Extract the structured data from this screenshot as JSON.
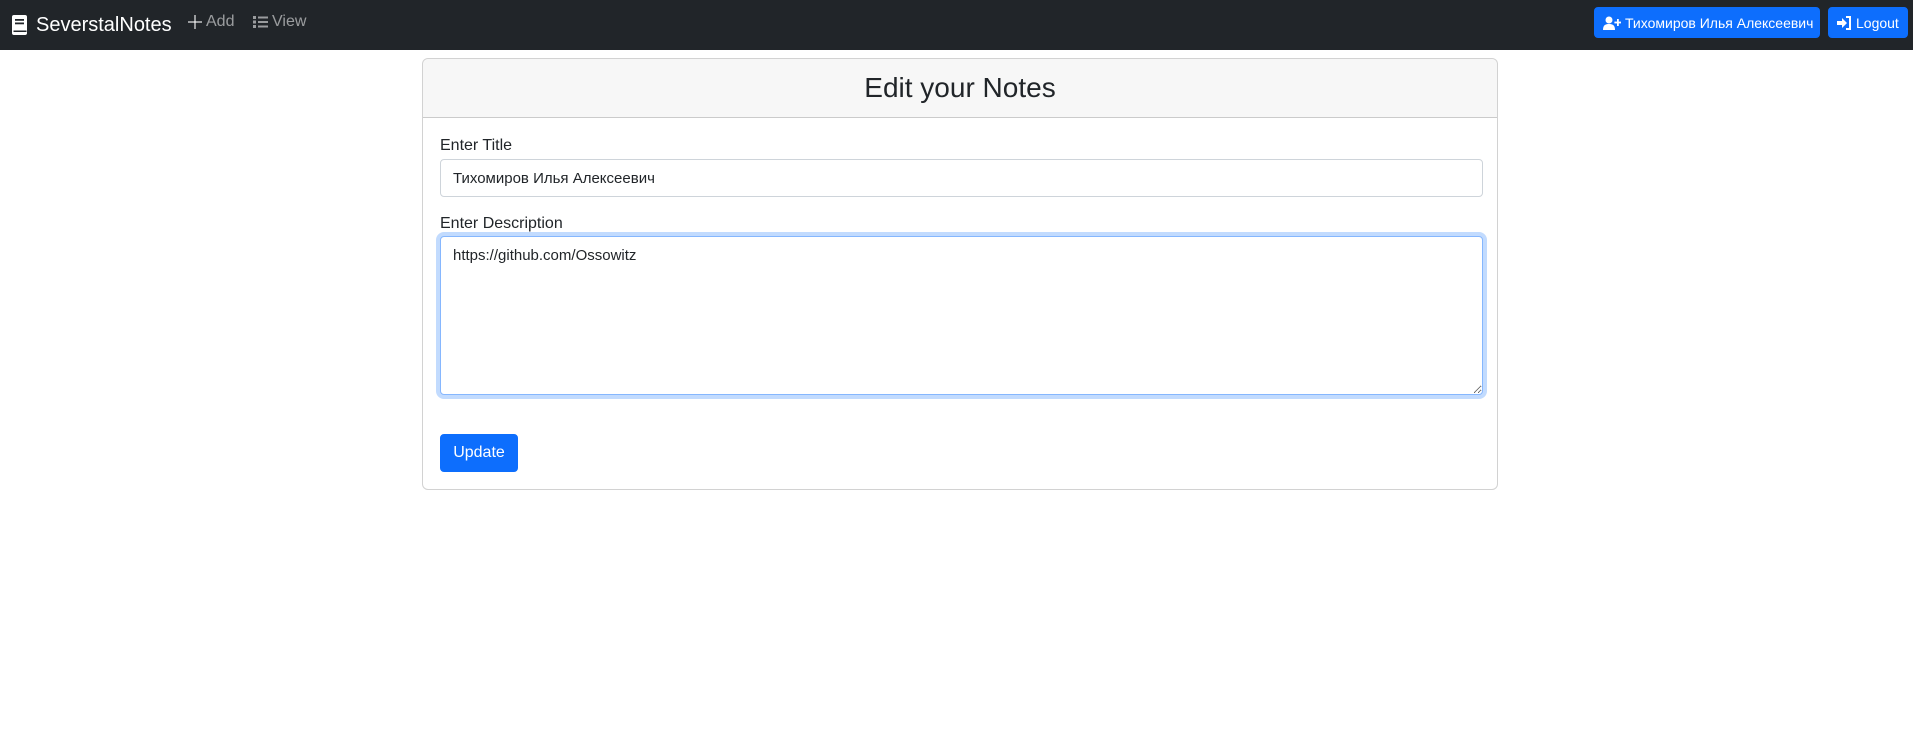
{
  "navbar": {
    "brand": "SeverstalNotes",
    "add_label": "Add",
    "view_label": "View",
    "user_button_label": "Тихомиров Илья Алексеевич",
    "logout_label": "Logout"
  },
  "card": {
    "heading": "Edit your Notes"
  },
  "form": {
    "title_label": "Enter Title",
    "title_value": "Тихомиров Илья Алексеевич",
    "description_label": "Enter Description",
    "description_value": "https://github.com/Ossowitz",
    "submit_label": "Update"
  },
  "colors": {
    "navbar_bg": "#212529",
    "primary": "#0d6efd"
  },
  "icons": {
    "brand": "book-icon",
    "add": "plus-icon",
    "view": "list-icon",
    "user": "user-plus-icon",
    "logout": "sign-in-icon"
  }
}
